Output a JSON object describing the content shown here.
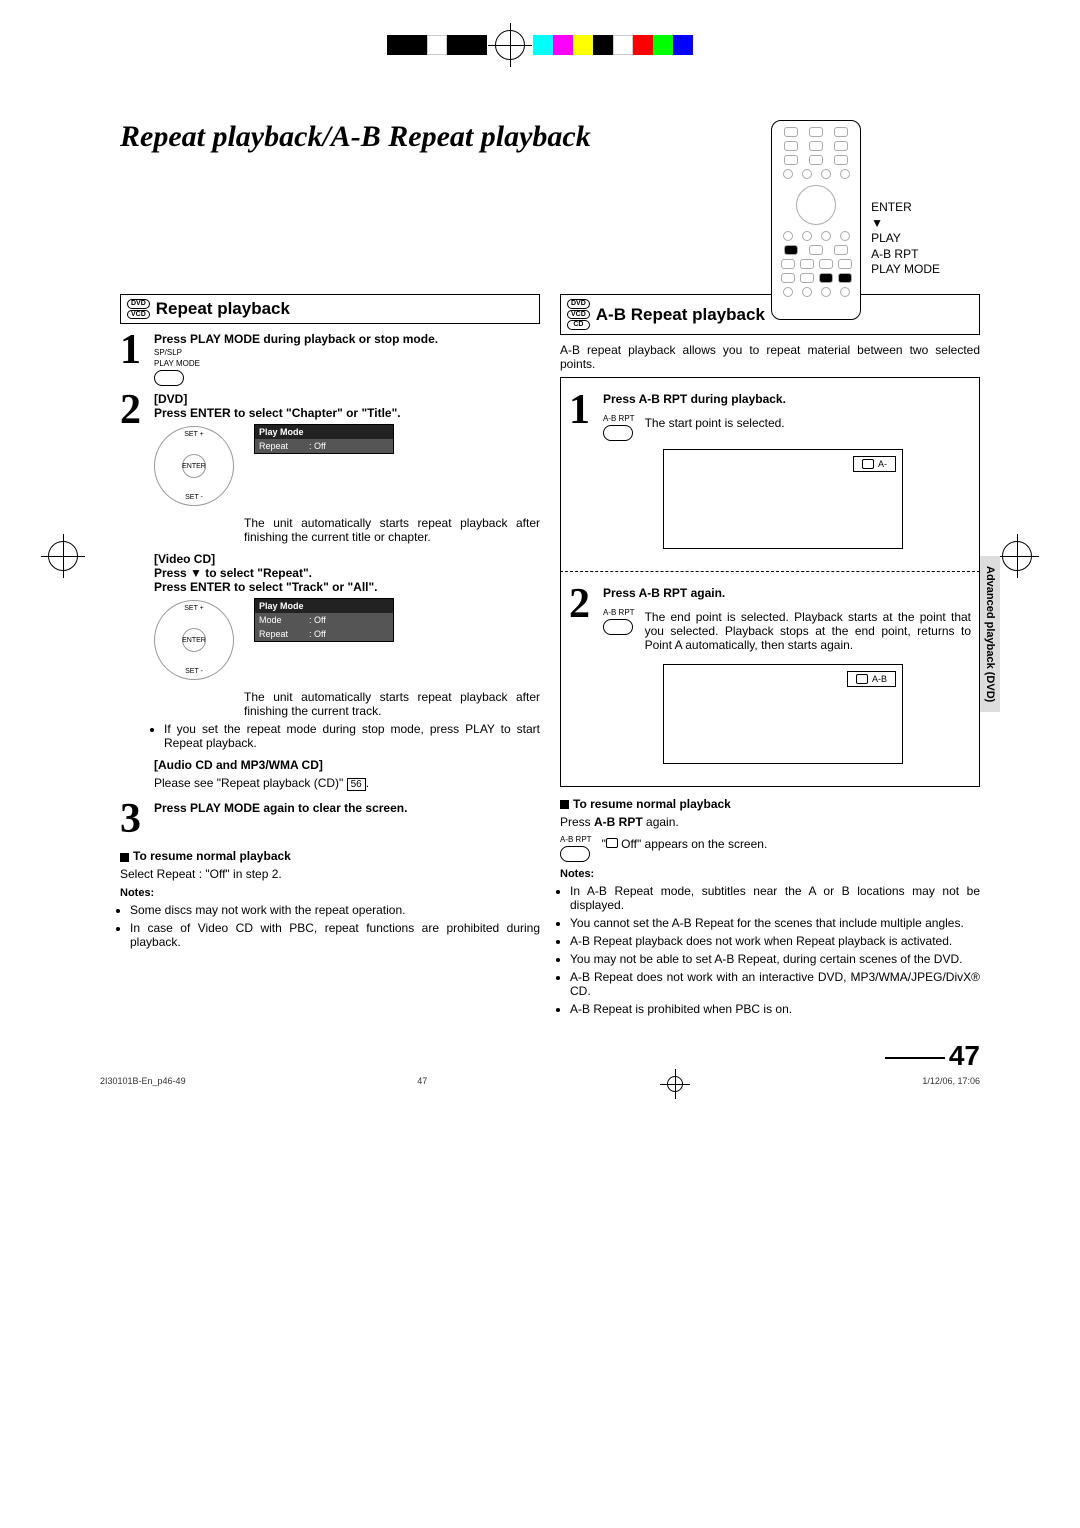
{
  "title": "Repeat playback/A-B Repeat playback",
  "remote_labels": [
    "ENTER",
    "▼",
    "PLAY",
    "A-B RPT",
    "PLAY MODE"
  ],
  "side_tab": "Advanced playback (DVD)",
  "page_number": "47",
  "footer": {
    "doc": "2I30101B-En_p46-49",
    "pg": "47",
    "date": "1/12/06, 17:06"
  },
  "left": {
    "heading": "Repeat playback",
    "badges": [
      "DVD",
      "VCD"
    ],
    "step1": {
      "text": "Press PLAY MODE during playback or stop mode.",
      "btn_top": "SP/SLP",
      "btn_bot": "PLAY MODE"
    },
    "step2": {
      "dvd_label": "[DVD]",
      "dvd_text": "Press ENTER to select \"Chapter\" or \"Title\".",
      "enter": "ENTER",
      "set_plus": "SET +",
      "set_minus": "SET -",
      "osd1_title": "Play Mode",
      "osd1_k1": "Repeat",
      "osd1_v1": ": Off",
      "para1": "The unit automatically starts repeat playback after finishing the current title or chapter.",
      "vcd_label": "[Video CD]",
      "vcd_l1": "Press ▼ to select \"Repeat\".",
      "vcd_l2": "Press ENTER to select \"Track\" or \"All\".",
      "osd2_title": "Play Mode",
      "osd2_k1": "Mode",
      "osd2_v1": ": Off",
      "osd2_k2": "Repeat",
      "osd2_v2": ": Off",
      "para2": "The unit automatically starts repeat playback after finishing the current track.",
      "bullet1": "If you set the repeat mode during stop mode, press PLAY to start Repeat playback.",
      "cd_label": "[Audio CD and MP3/WMA CD]",
      "cd_text": "Please see \"Repeat playback (CD)\" ",
      "cd_ref": "56",
      "cd_text_end": "."
    },
    "step3": {
      "text": "Press PLAY MODE again to clear the screen."
    },
    "resume_h": "To resume normal playback",
    "resume_t": "Select Repeat : \"Off\" in step 2.",
    "notes_h": "Notes:",
    "notes": [
      "Some discs may not work with the repeat operation.",
      "In case of Video CD with PBC, repeat functions are prohibited during playback."
    ]
  },
  "right": {
    "heading": "A-B Repeat playback",
    "badges": [
      "DVD",
      "VCD",
      "CD"
    ],
    "intro": "A-B repeat playback allows you to repeat material between two selected points.",
    "step1": {
      "text": "Press A-B RPT during playback.",
      "btn": "A-B RPT",
      "result": "The start point is selected.",
      "screen": "A-"
    },
    "step2": {
      "text": "Press A-B RPT again.",
      "btn": "A-B RPT",
      "result": "The end point is selected. Playback starts at the point that you selected. Playback stops at the end point, returns to Point A automatically, then starts again.",
      "screen": "A-B"
    },
    "resume_h": "To resume normal playback",
    "resume_t1": "Press ",
    "resume_bold": "A-B RPT",
    "resume_t2": " again.",
    "resume_btn": "A-B RPT",
    "resume_screen": "\"       Off\" appears on the screen.",
    "notes_h": "Notes:",
    "notes": [
      "In A-B Repeat mode, subtitles near the A or B locations may not be displayed.",
      "You cannot set the A-B Repeat for the scenes that include multiple angles.",
      "A-B Repeat playback does not work when Repeat playback is activated.",
      "You may not be able to set A-B Repeat, during certain scenes of the DVD.",
      "A-B Repeat does not work with an interactive DVD, MP3/WMA/JPEG/DivX® CD.",
      "A-B Repeat is prohibited when PBC is on."
    ]
  }
}
